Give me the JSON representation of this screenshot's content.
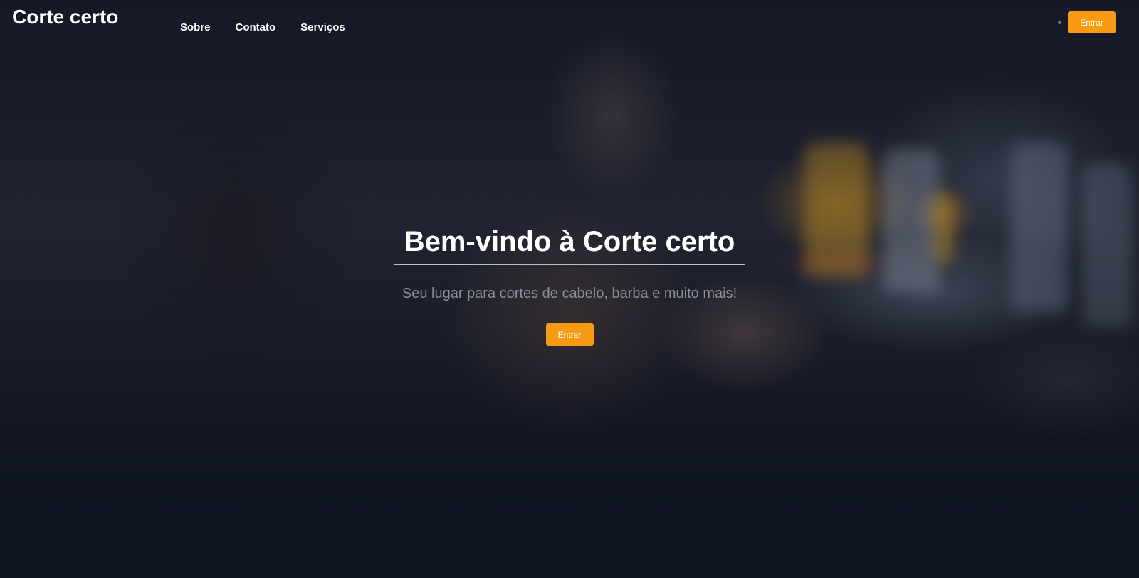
{
  "header": {
    "brand": "Corte certo",
    "nav": [
      "Sobre",
      "Contato",
      "Serviços"
    ],
    "login_label": "Entrar"
  },
  "hero": {
    "title": "Bem-vindo à Corte certo",
    "subtitle": "Seu lugar para cortes de cabelo, barba e muito mais!",
    "cta_label": "Entrar"
  },
  "colors": {
    "accent": "#f79a14",
    "background": "#111625",
    "subtitle": "#8b8f98"
  }
}
